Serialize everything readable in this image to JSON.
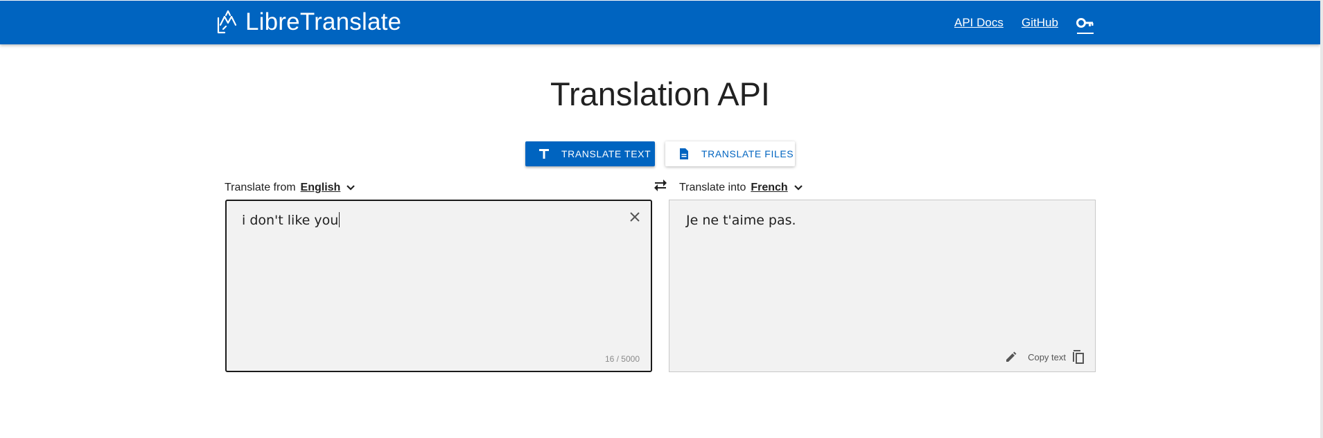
{
  "navbar": {
    "brand": "LibreTranslate",
    "links": [
      "API Docs",
      "GitHub"
    ],
    "key_icon": "key-icon",
    "logo_icon": "libretranslate-logo-icon"
  },
  "page": {
    "title": "Translation API"
  },
  "modes": {
    "translate_text": "TRANSLATE TEXT",
    "translate_files": "TRANSLATE FILES"
  },
  "source": {
    "label": "Translate from",
    "language": "English",
    "text": "i don't like you",
    "char_count": "16 / 5000"
  },
  "target": {
    "label": "Translate into",
    "language": "French",
    "text": "Je ne t'aime pas.",
    "copy_label": "Copy text"
  },
  "colors": {
    "primary": "#0064c0",
    "panel": "#f2f2f2"
  }
}
